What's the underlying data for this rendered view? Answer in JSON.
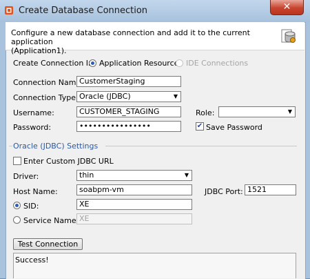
{
  "window": {
    "title": "Create Database Connection",
    "close_glyph": "✕"
  },
  "header": {
    "description_line1": "Configure a new database connection and add it to the current application",
    "description_line2": "(Application1).",
    "icon": "database-icon"
  },
  "create_in": {
    "label": "Create Connection In:",
    "options": [
      {
        "label": "Application Resources",
        "selected": true,
        "enabled": true
      },
      {
        "label": "IDE Connections",
        "selected": false,
        "enabled": false
      }
    ]
  },
  "form": {
    "connection_name_label": "Connection Name:",
    "connection_name_value": "CustomerStaging",
    "connection_type_label": "Connection Type:",
    "connection_type_value": "Oracle (JDBC)",
    "username_label": "Username:",
    "username_value": "CUSTOMER_STAGING",
    "role_label": "Role:",
    "role_value": "",
    "password_label": "Password:",
    "password_value": "••••••••••••••••",
    "save_password_label": "Save Password",
    "save_password_checked": true
  },
  "oracle_settings": {
    "section_label": "Oracle (JDBC) Settings",
    "custom_url_label": "Enter Custom JDBC URL",
    "custom_url_checked": false,
    "driver_label": "Driver:",
    "driver_value": "thin",
    "host_label": "Host Name:",
    "host_value": "soabpm-vm",
    "port_label": "JDBC Port:",
    "port_value": "1521",
    "sid_label": "SID:",
    "sid_value": "XE",
    "sid_selected": true,
    "service_label": "Service Name:",
    "service_value": "XE",
    "service_selected": false
  },
  "test": {
    "button_label": "Test Connection",
    "result_text": "Success!"
  },
  "colors": {
    "accent": "#2b58a4",
    "close": "#c7442f"
  }
}
